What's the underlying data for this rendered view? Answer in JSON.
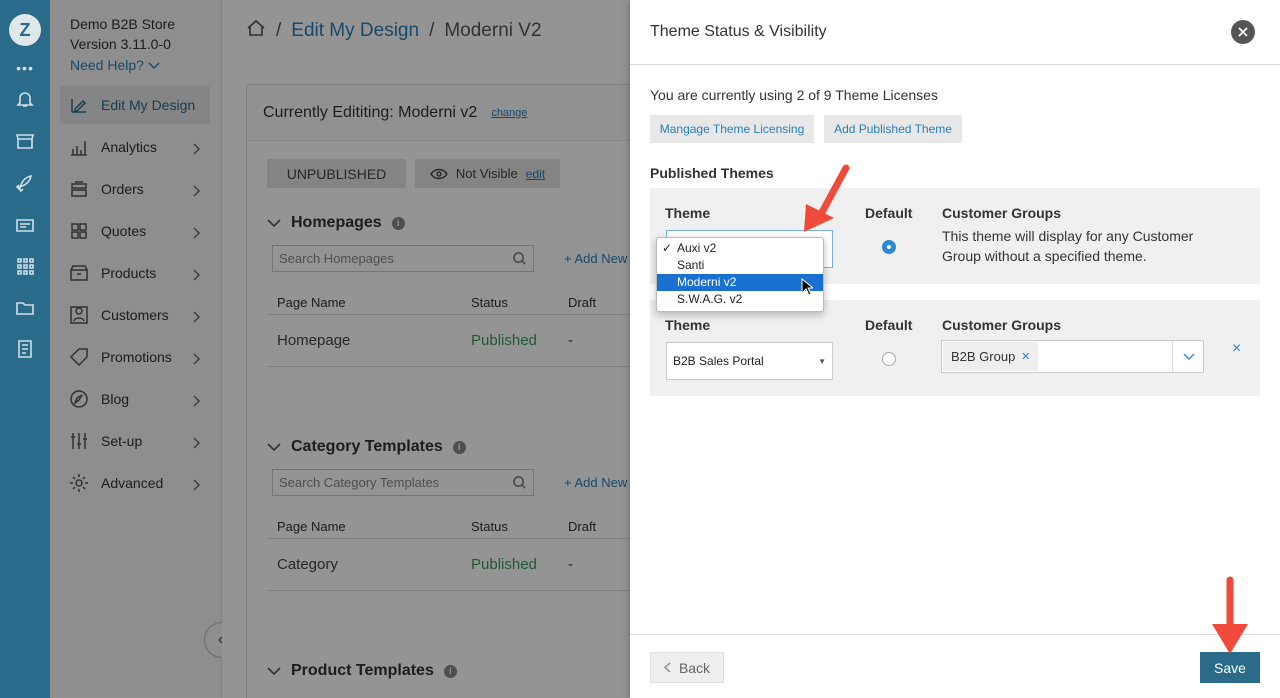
{
  "rail": {
    "logo": "Z",
    "more": "•••"
  },
  "nav": {
    "store_name": "Demo B2B Store",
    "version": "Version 3.11.0-0",
    "need_help": "Need Help?",
    "items": [
      {
        "label": "Edit My Design",
        "icon": "edit-design-icon",
        "active": true
      },
      {
        "label": "Analytics",
        "icon": "analytics-icon"
      },
      {
        "label": "Orders",
        "icon": "orders-icon"
      },
      {
        "label": "Quotes",
        "icon": "quotes-icon"
      },
      {
        "label": "Products",
        "icon": "products-icon"
      },
      {
        "label": "Customers",
        "icon": "customers-icon"
      },
      {
        "label": "Promotions",
        "icon": "promotions-icon"
      },
      {
        "label": "Blog",
        "icon": "blog-icon"
      },
      {
        "label": "Set-up",
        "icon": "setup-icon"
      },
      {
        "label": "Advanced",
        "icon": "advanced-icon"
      }
    ]
  },
  "main": {
    "breadcrumb": {
      "sep": "/",
      "link": "Edit My Design",
      "current": "Moderni V2"
    },
    "editing_title": "Currently Edititing: Moderni v2",
    "change_link": "change",
    "unpublished": "UNPUBLISHED",
    "visibility": "Not Visible",
    "edit_link": "edit",
    "sections": [
      {
        "title": "Homepages",
        "search_placeholder": "Search Homepages",
        "add_new": "+ Add New",
        "columns": [
          "Page Name",
          "Status",
          "Draft"
        ],
        "row": {
          "name": "Homepage",
          "status": "Published",
          "draft": "-"
        }
      },
      {
        "title": "Category Templates",
        "search_placeholder": "Search Category Templates",
        "add_new": "+ Add New",
        "columns": [
          "Page Name",
          "Status",
          "Draft"
        ],
        "row": {
          "name": "Category",
          "status": "Published",
          "draft": "-"
        }
      },
      {
        "title": "Product Templates"
      }
    ]
  },
  "drawer": {
    "title": "Theme Status & Visibility",
    "license_text": "You are currently using 2 of 9 Theme Licenses",
    "manage_btn": "Mangage Theme Licensing",
    "add_btn": "Add Published Theme",
    "published_title": "Published Themes",
    "col_theme": "Theme",
    "col_default": "Default",
    "col_groups": "Customer Groups",
    "row1": {
      "default_selected": true,
      "groups_text": "This theme will display for any Customer Group without a specified theme."
    },
    "row2": {
      "theme": "B2B Sales Portal",
      "default_selected": false,
      "group_chip": "B2B Group",
      "chip_remove": "×",
      "remove": "×"
    },
    "dropdown": {
      "options": [
        "Auxi v2",
        "Santi",
        "Moderni v2",
        "S.W.A.G. v2"
      ],
      "checked": "Auxi v2",
      "highlighted": "Moderni v2",
      "check_mark": "✓"
    },
    "back_btn": "Back",
    "save_btn": "Save"
  },
  "colors": {
    "rail": "#2a6b8a",
    "link": "#2a7fb8",
    "published": "#3a9a5a",
    "save": "#2a6b8a",
    "annotation_arrow": "#ef4a3a"
  }
}
